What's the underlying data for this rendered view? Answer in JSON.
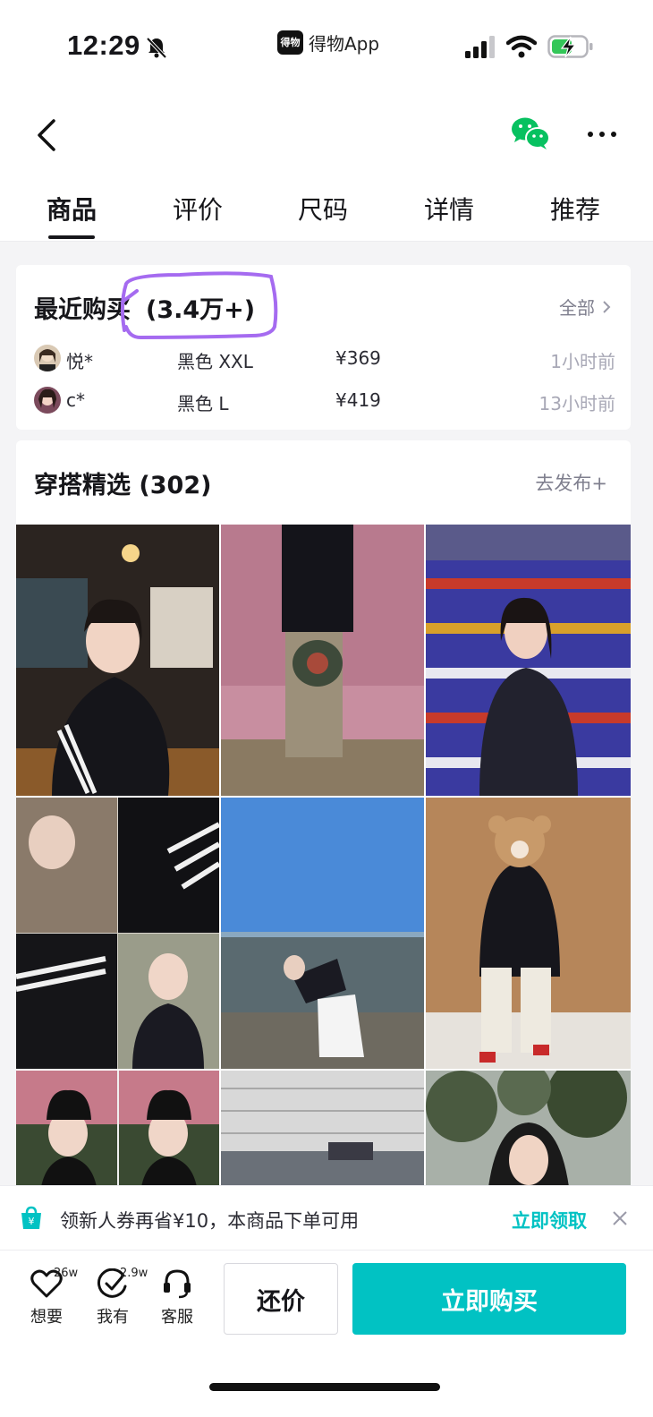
{
  "status_bar": {
    "time": "12:29",
    "app_name": "得物App",
    "app_logo_text": "得物"
  },
  "tabs": [
    {
      "label": "商品",
      "active": true
    },
    {
      "label": "评价",
      "active": false
    },
    {
      "label": "尺码",
      "active": false
    },
    {
      "label": "详情",
      "active": false
    },
    {
      "label": "推荐",
      "active": false
    }
  ],
  "recent_purchases": {
    "title": "最近购买",
    "count": "(3.4万+)",
    "all_label": "全部",
    "rows": [
      {
        "name": "悦*",
        "spec": "黑色 XXL",
        "price": "¥369",
        "time": "1小时前"
      },
      {
        "name": "c*",
        "spec": "黑色 L",
        "price": "¥419",
        "time": "13小时前"
      }
    ]
  },
  "outfit": {
    "title": "穿搭精选 (302)",
    "publish_label": "去发布+"
  },
  "coupon": {
    "text": "领新人券再省¥10，本商品下单可用",
    "claim_label": "立即领取"
  },
  "bottom_bar": {
    "want": {
      "label": "想要",
      "count": "26w"
    },
    "own": {
      "label": "我有",
      "count": "2.9w"
    },
    "service": {
      "label": "客服"
    },
    "bargain_label": "还价",
    "buy_label": "立即购买"
  },
  "colors": {
    "accent": "#01c2c3",
    "highlight_stroke": "#a56bf0",
    "wechat_green": "#07c160"
  }
}
